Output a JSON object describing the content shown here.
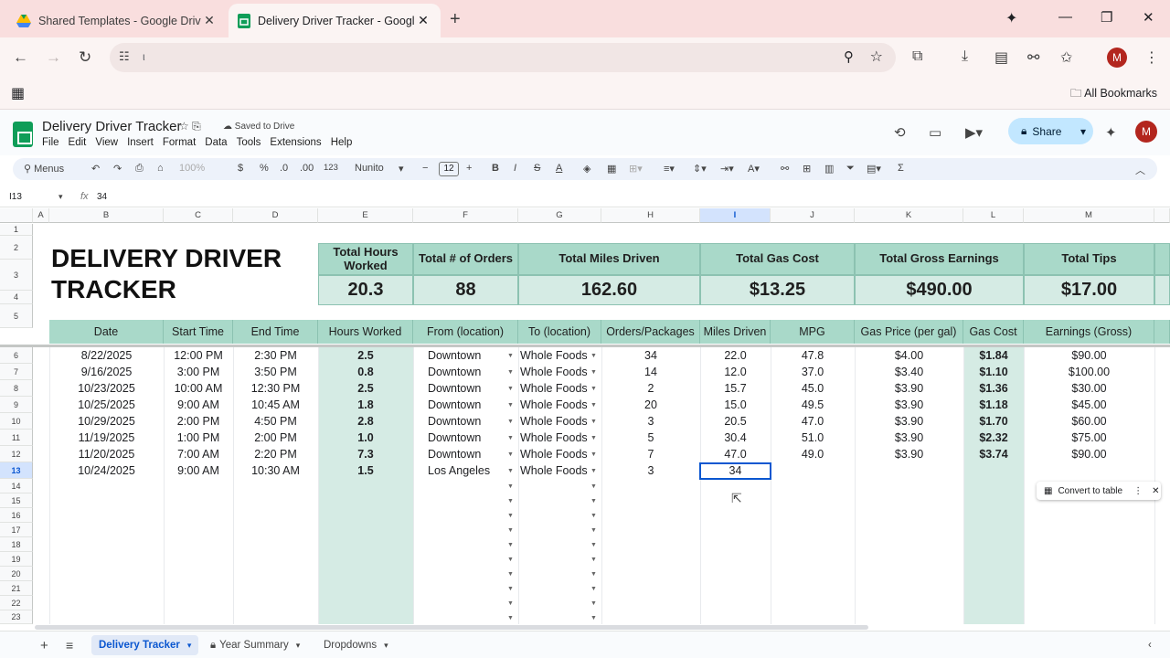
{
  "browser": {
    "tabs": [
      {
        "title": "Shared Templates - Google Driv",
        "active": false
      },
      {
        "title": "Delivery Driver Tracker - Google",
        "active": true
      }
    ],
    "url": "ι",
    "bookmarks_label": "All Bookmarks",
    "profile_initial": "M"
  },
  "doc": {
    "title": "Delivery Driver Tracker",
    "saved_status": "Saved to Drive",
    "menu": [
      "File",
      "Edit",
      "View",
      "Insert",
      "Format",
      "Data",
      "Tools",
      "Extensions",
      "Help"
    ],
    "share_label": "Share",
    "profile_initial": "M"
  },
  "toolbar": {
    "menus_label": "Menus",
    "zoom": "100%",
    "currency": "$",
    "percent": "%",
    "dec_decrease": ".0",
    "dec_increase": ".00",
    "number_format": "123",
    "font": "Nunito",
    "font_size": "12",
    "minus": "−",
    "plus": "+",
    "bold": "B",
    "italic": "I",
    "strike": "S",
    "textcolor": "A",
    "sigma": "Σ"
  },
  "formula_bar": {
    "cell": "I13",
    "fx": "fx",
    "value": "34"
  },
  "columns": [
    "A",
    "B",
    "C",
    "D",
    "E",
    "F",
    "G",
    "H",
    "I",
    "J",
    "K",
    "L",
    "M"
  ],
  "selected_column": "I",
  "rows": [
    "1",
    "2",
    "3",
    "4",
    "5",
    "6",
    "7",
    "8",
    "9",
    "10",
    "11",
    "12",
    "13",
    "14",
    "15",
    "16",
    "17",
    "18",
    "19",
    "20",
    "21",
    "22",
    "23"
  ],
  "selected_row": "13",
  "tracker": {
    "title_line1": "DELIVERY DRIVER",
    "title_line2": "TRACKER",
    "summary": [
      {
        "label": "Total Hours Worked",
        "value": "20.3"
      },
      {
        "label": "Total # of Orders",
        "value": "88"
      },
      {
        "label": "Total Miles Driven",
        "value": "162.60"
      },
      {
        "label": "Total Gas Cost",
        "value": "$13.25"
      },
      {
        "label": "Total Gross Earnings",
        "value": "$490.00"
      },
      {
        "label": "Total Tips",
        "value": "$17.00"
      }
    ],
    "headers": [
      "Date",
      "Start Time",
      "End Time",
      "Hours Worked",
      "From (location)",
      "To (location)",
      "Orders/Packages",
      "Miles Driven",
      "MPG",
      "Gas Price (per gal)",
      "Gas Cost",
      "Earnings (Gross)"
    ],
    "data": [
      [
        "8/22/2025",
        "12:00 PM",
        "2:30 PM",
        "2.5",
        "Downtown",
        "Whole Foods",
        "34",
        "22.0",
        "47.8",
        "$4.00",
        "$1.84",
        "$90.00"
      ],
      [
        "9/16/2025",
        "3:00 PM",
        "3:50 PM",
        "0.8",
        "Downtown",
        "Whole Foods",
        "14",
        "12.0",
        "37.0",
        "$3.40",
        "$1.10",
        "$100.00"
      ],
      [
        "10/23/2025",
        "10:00 AM",
        "12:30 PM",
        "2.5",
        "Downtown",
        "Whole Foods",
        "2",
        "15.7",
        "45.0",
        "$3.90",
        "$1.36",
        "$30.00"
      ],
      [
        "10/25/2025",
        "9:00 AM",
        "10:45 AM",
        "1.8",
        "Downtown",
        "Whole Foods",
        "20",
        "15.0",
        "49.5",
        "$3.90",
        "$1.18",
        "$45.00"
      ],
      [
        "10/29/2025",
        "2:00 PM",
        "4:50 PM",
        "2.8",
        "Downtown",
        "Whole Foods",
        "3",
        "20.5",
        "47.0",
        "$3.90",
        "$1.70",
        "$60.00"
      ],
      [
        "11/19/2025",
        "1:00 PM",
        "2:00 PM",
        "1.0",
        "Downtown",
        "Whole Foods",
        "5",
        "30.4",
        "51.0",
        "$3.90",
        "$2.32",
        "$75.00"
      ],
      [
        "11/20/2025",
        "7:00 AM",
        "2:20 PM",
        "7.3",
        "Downtown",
        "Whole Foods",
        "7",
        "47.0",
        "49.0",
        "$3.90",
        "$3.74",
        "$90.00"
      ],
      [
        "10/24/2025",
        "9:00 AM",
        "10:30 AM",
        "1.5",
        "Los Angeles",
        "Whole Foods",
        "3",
        "34",
        "",
        "",
        "",
        ""
      ]
    ]
  },
  "convert_chip": "Convert to table",
  "sheet_tabs": [
    {
      "label": "Delivery Tracker",
      "active": true
    },
    {
      "label": "Year Summary",
      "active": false
    },
    {
      "label": "Dropdowns",
      "active": false
    }
  ],
  "colors": {
    "header_green": "#a9d9c9",
    "light_green": "#d5ebe4",
    "selection_blue": "#0b57d0",
    "tabbar": "#f9dede"
  }
}
